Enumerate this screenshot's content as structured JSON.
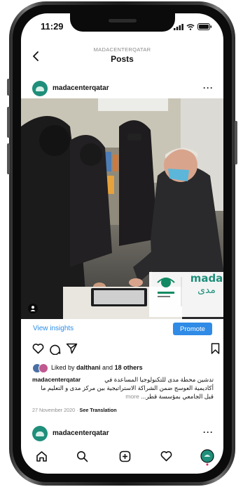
{
  "status_bar": {
    "time": "11:29"
  },
  "header": {
    "account_caps": "MADACENTERQATAR",
    "title": "Posts"
  },
  "post": {
    "username": "madacenterqatar",
    "image_logo": {
      "word": "mada",
      "arabic": "مدى"
    },
    "insights_label": "View insights",
    "promote_label": "Promote",
    "likes": {
      "prefix": "Liked by ",
      "user": "dalthani",
      "middle": " and ",
      "count": "18 others"
    },
    "caption": {
      "username": "madacenterqatar",
      "line1_ar": "تدشين محطة مدى للتكنولوجيا المساعدة في",
      "line2_ar": "أكاديمية العوسج ضمن الشراكة الاستراتيجية بين مركز مدى و التعليم ما",
      "line3_ar": "قبل الجامعي بمؤسسة قطر...",
      "more": "more"
    },
    "date": "27 November 2020",
    "separator": "·",
    "see_translation": "See Translation"
  },
  "next_post": {
    "username": "madacenterqatar"
  },
  "colors": {
    "link": "#2b8de8",
    "promote_bg": "#2f8be6",
    "brand": "#1f8f7b"
  },
  "icons": {
    "back": "chevron-left-icon",
    "more": "more-horizontal-icon",
    "like": "heart-icon",
    "comment": "comment-icon",
    "share": "send-icon",
    "save": "bookmark-icon",
    "tab_home": "home-icon",
    "tab_search": "search-icon",
    "tab_create": "plus-square-icon",
    "tab_activity": "heart-icon",
    "tab_profile": "profile-avatar-icon"
  }
}
